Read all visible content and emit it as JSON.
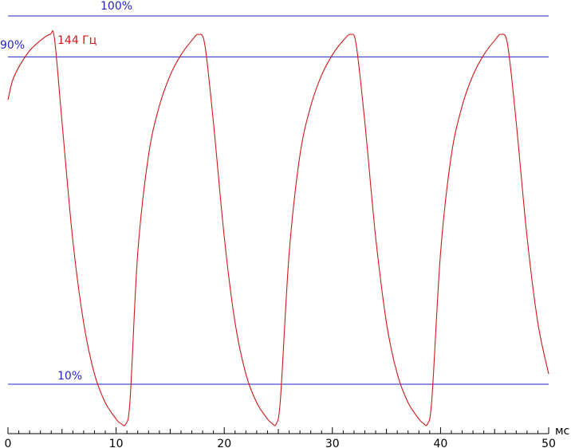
{
  "chart_data": {
    "type": "line",
    "title": "",
    "xlabel": "мс",
    "ylabel": "",
    "xlim": [
      0,
      50
    ],
    "ylim": [
      0,
      100
    ],
    "x_major_ticks": [
      0,
      10,
      20,
      30,
      40,
      50
    ],
    "x_minor_step": 1,
    "grid": false,
    "reference_lines": [
      {
        "value": 100,
        "label": "100%"
      },
      {
        "value": 90,
        "label": "90%"
      },
      {
        "value": 10,
        "label": "10%"
      }
    ],
    "series": [
      {
        "name": "144 Гц",
        "color": "#d01818",
        "x": [
          0,
          0.4,
          1,
          2,
          3,
          3.9,
          4.3,
          5,
          6,
          7,
          8,
          9,
          10,
          10.4,
          10.9,
          11.3,
          12,
          13,
          14,
          15,
          16,
          17,
          17.6,
          18.2,
          19,
          20,
          21,
          22,
          23,
          24,
          24.4,
          24.8,
          25.2,
          26,
          27,
          28,
          29,
          30,
          31,
          31.7,
          32.2,
          33,
          34,
          35,
          36,
          37,
          38,
          38.4,
          38.8,
          39.2,
          40,
          41,
          42,
          43,
          44,
          45,
          45.6,
          46.2,
          47,
          48,
          49,
          50
        ],
        "y": [
          79.5,
          84,
          87.5,
          91.5,
          94,
          95.5,
          94.5,
          74,
          45,
          25,
          12.5,
          5.5,
          1.5,
          0.5,
          0.3,
          6.5,
          42,
          66,
          78,
          85.5,
          90.5,
          94,
          95.5,
          93,
          74,
          46,
          25,
          12.5,
          5.5,
          1.5,
          0.5,
          0.3,
          6.5,
          42,
          66,
          78,
          85.5,
          90.5,
          94,
          95.5,
          93,
          74,
          46,
          25,
          12.5,
          5.5,
          1.5,
          0.5,
          0.3,
          6.5,
          42,
          66,
          78,
          85.5,
          90.5,
          94,
          95.5,
          93,
          74,
          46,
          25,
          12.5
        ]
      }
    ]
  },
  "colors": {
    "reference_line": "#2424c8",
    "series": "#d01818",
    "axis": "#000000"
  }
}
